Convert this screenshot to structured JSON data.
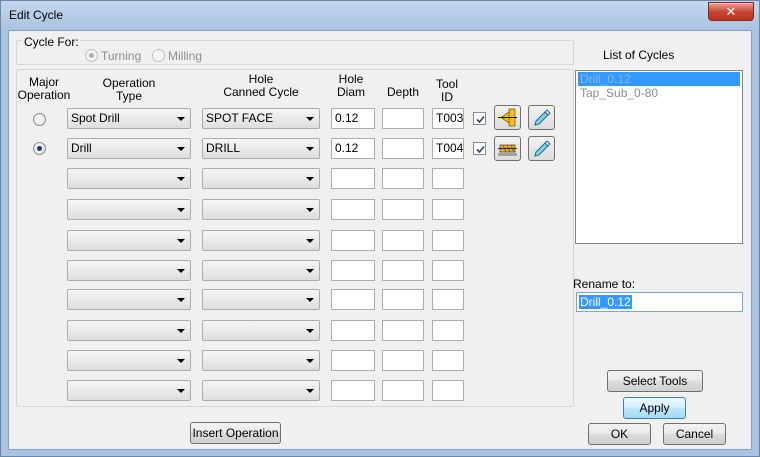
{
  "window": {
    "title": "Edit Cycle",
    "close_glyph": "✕"
  },
  "cycle_for": {
    "label": "Cycle For:",
    "options": [
      {
        "label": "Turning",
        "checked": true
      },
      {
        "label": "Milling",
        "checked": false
      }
    ]
  },
  "table": {
    "headers": {
      "major_line1": "Major",
      "major_line2": "Operation",
      "optype_line1": "Operation",
      "optype_line2": "Type",
      "canned_line1": "Hole",
      "canned_line2": "Canned Cycle",
      "diam_line1": "Hole",
      "diam_line2": "Diam",
      "depth": "Depth",
      "toolid_line1": "Tool",
      "toolid_line2": "ID"
    },
    "rows": [
      {
        "major": false,
        "op_type": "Spot Drill",
        "canned": "SPOT FACE",
        "diam": "0.12",
        "depth": "",
        "tool_id": "T003",
        "checked": true,
        "icon": "spot-drill-icon"
      },
      {
        "major": true,
        "op_type": "Drill",
        "canned": "DRILL",
        "diam": "0.12",
        "depth": "",
        "tool_id": "T004",
        "checked": true,
        "icon": "drill-icon"
      },
      {
        "op_type": "",
        "canned": "",
        "diam": "",
        "depth": "",
        "tool_id": ""
      },
      {
        "op_type": "",
        "canned": "",
        "diam": "",
        "depth": "",
        "tool_id": ""
      },
      {
        "op_type": "",
        "canned": "",
        "diam": "",
        "depth": "",
        "tool_id": ""
      },
      {
        "op_type": "",
        "canned": "",
        "diam": "",
        "depth": "",
        "tool_id": ""
      },
      {
        "op_type": "",
        "canned": "",
        "diam": "",
        "depth": "",
        "tool_id": ""
      },
      {
        "op_type": "",
        "canned": "",
        "diam": "",
        "depth": "",
        "tool_id": ""
      },
      {
        "op_type": "",
        "canned": "",
        "diam": "",
        "depth": "",
        "tool_id": ""
      },
      {
        "op_type": "",
        "canned": "",
        "diam": "",
        "depth": "",
        "tool_id": ""
      }
    ]
  },
  "list_of_cycles": {
    "label": "List of Cycles",
    "items": [
      "Drill_0.12",
      "Tap_Sub_0-80"
    ],
    "selected_index": 0
  },
  "rename": {
    "label": "Rename to:",
    "value": "Drill_0.12"
  },
  "buttons": {
    "insert_operation": "Insert Operation",
    "select_tools": "Select Tools",
    "apply": "Apply",
    "ok": "OK",
    "cancel": "Cancel"
  },
  "colors": {
    "selection": "#3399ff",
    "title_bar": "#a9c3e2",
    "close_button": "#c7432f"
  }
}
